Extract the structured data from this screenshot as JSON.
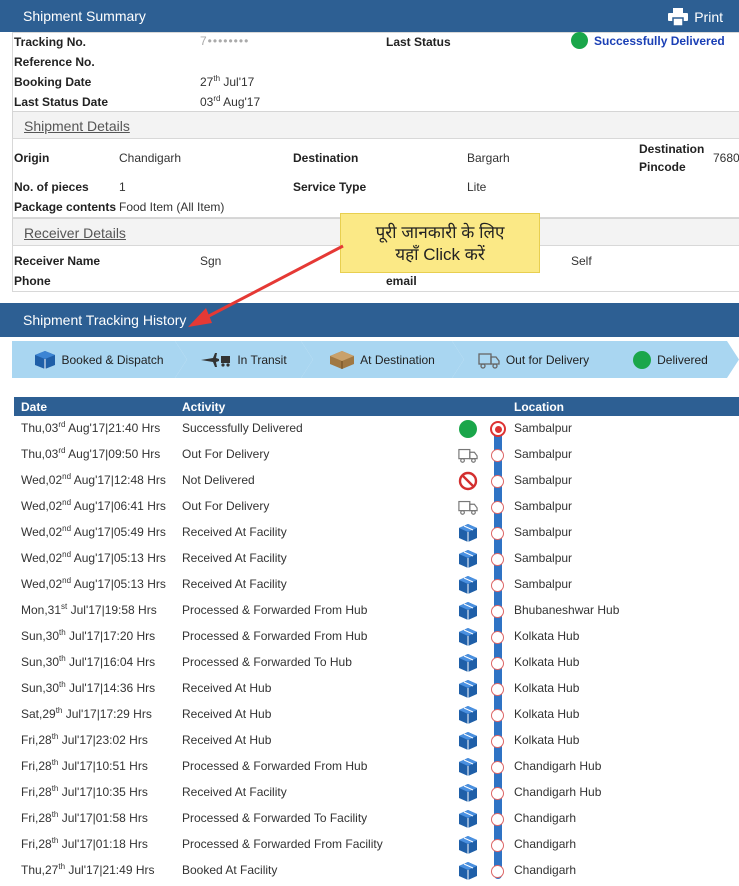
{
  "summary": {
    "title": "Shipment Summary",
    "print_label": "Print",
    "tracking_label": "Tracking No.",
    "tracking_value": "7••••••••",
    "last_status_label": "Last Status",
    "last_status_value": "Successfully Delivered",
    "reference_label": "Reference No.",
    "booking_label": "Booking Date",
    "booking_day": "27",
    "booking_sup": "th",
    "booking_rest": " Jul'17",
    "last_status_date_label": "Last Status Date",
    "last_status_day": "03",
    "last_status_sup": "rd",
    "last_status_rest": " Aug'17"
  },
  "details": {
    "title": "Shipment Details",
    "origin_label": "Origin",
    "origin_value": "Chandigarh",
    "destination_label": "Destination",
    "destination_value": "Bargarh",
    "pincode_label_1": "Destination",
    "pincode_label_2": "Pincode",
    "pincode_value": "7680",
    "pieces_label": "No. of pieces",
    "pieces_value": "1",
    "service_label": "Service Type",
    "service_value": "Lite",
    "contents_label": "Package contents",
    "contents_value": "Food Item (All Item)"
  },
  "receiver": {
    "title": "Receiver Details",
    "name_label": "Receiver Name",
    "name_value": "Sgn",
    "relation_value": "Self",
    "phone_label": "Phone",
    "email_label": "email"
  },
  "callout": {
    "line1": "पूरी जानकारी के लिए",
    "line2": "यहाँ Click करें"
  },
  "tracking": {
    "title": "Shipment Tracking History",
    "steps": [
      {
        "label": "Booked & Dispatch",
        "icon": "box-icon"
      },
      {
        "label": "In Transit",
        "icon": "transit-icon"
      },
      {
        "label": "At Destination",
        "icon": "package-icon"
      },
      {
        "label": "Out for Delivery",
        "icon": "delivery-van-icon"
      },
      {
        "label": "Delivered",
        "icon": "green-dot-icon"
      }
    ],
    "columns": {
      "date": "Date",
      "activity": "Activity",
      "location": "Location"
    },
    "rows": [
      {
        "d1": "Thu,03",
        "sup": "rd",
        "d2": " Aug'17|21:40 Hrs",
        "activity": "Successfully Delivered",
        "icon": "green-dot-icon",
        "location": "Sambalpur"
      },
      {
        "d1": "Thu,03",
        "sup": "rd",
        "d2": " Aug'17|09:50 Hrs",
        "activity": "Out For Delivery",
        "icon": "delivery-van-icon",
        "location": "Sambalpur"
      },
      {
        "d1": "Wed,02",
        "sup": "nd",
        "d2": " Aug'17|12:48 Hrs",
        "activity": "Not Delivered",
        "icon": "not-delivered-icon",
        "location": "Sambalpur"
      },
      {
        "d1": "Wed,02",
        "sup": "nd",
        "d2": " Aug'17|06:41 Hrs",
        "activity": "Out For Delivery",
        "icon": "delivery-van-icon",
        "location": "Sambalpur"
      },
      {
        "d1": "Wed,02",
        "sup": "nd",
        "d2": " Aug'17|05:49 Hrs",
        "activity": "Received At Facility",
        "icon": "box-icon",
        "location": "Sambalpur"
      },
      {
        "d1": "Wed,02",
        "sup": "nd",
        "d2": " Aug'17|05:13 Hrs",
        "activity": "Received At Facility",
        "icon": "box-icon",
        "location": "Sambalpur"
      },
      {
        "d1": "Wed,02",
        "sup": "nd",
        "d2": " Aug'17|05:13 Hrs",
        "activity": "Received At Facility",
        "icon": "box-icon",
        "location": "Sambalpur"
      },
      {
        "d1": "Mon,31",
        "sup": "st",
        "d2": " Jul'17|19:58 Hrs",
        "activity": "Processed & Forwarded From Hub",
        "icon": "box-icon",
        "location": "Bhubaneshwar Hub"
      },
      {
        "d1": "Sun,30",
        "sup": "th",
        "d2": " Jul'17|17:20 Hrs",
        "activity": "Processed & Forwarded From Hub",
        "icon": "box-icon",
        "location": "Kolkata Hub"
      },
      {
        "d1": "Sun,30",
        "sup": "th",
        "d2": " Jul'17|16:04 Hrs",
        "activity": "Processed & Forwarded To Hub",
        "icon": "box-icon",
        "location": "Kolkata Hub"
      },
      {
        "d1": "Sun,30",
        "sup": "th",
        "d2": " Jul'17|14:36 Hrs",
        "activity": "Received At Hub",
        "icon": "box-icon",
        "location": "Kolkata Hub"
      },
      {
        "d1": "Sat,29",
        "sup": "th",
        "d2": " Jul'17|17:29 Hrs",
        "activity": "Received At Hub",
        "icon": "box-icon",
        "location": "Kolkata Hub"
      },
      {
        "d1": "Fri,28",
        "sup": "th",
        "d2": " Jul'17|23:02 Hrs",
        "activity": "Received At Hub",
        "icon": "box-icon",
        "location": "Kolkata Hub"
      },
      {
        "d1": "Fri,28",
        "sup": "th",
        "d2": " Jul'17|10:51 Hrs",
        "activity": "Processed & Forwarded From Hub",
        "icon": "box-icon",
        "location": "Chandigarh Hub"
      },
      {
        "d1": "Fri,28",
        "sup": "th",
        "d2": " Jul'17|10:35 Hrs",
        "activity": "Received At Facility",
        "icon": "box-icon",
        "location": "Chandigarh Hub"
      },
      {
        "d1": "Fri,28",
        "sup": "th",
        "d2": " Jul'17|01:58 Hrs",
        "activity": "Processed & Forwarded To Facility",
        "icon": "box-icon",
        "location": "Chandigarh"
      },
      {
        "d1": "Fri,28",
        "sup": "th",
        "d2": " Jul'17|01:18 Hrs",
        "activity": "Processed & Forwarded From Facility",
        "icon": "box-icon",
        "location": "Chandigarh"
      },
      {
        "d1": "Thu,27",
        "sup": "th",
        "d2": " Jul'17|21:49 Hrs",
        "activity": "Booked At Facility",
        "icon": "box-icon",
        "location": "Chandigarh"
      }
    ]
  },
  "colors": {
    "header_blue": "#2d5f93",
    "step_blue": "#a9d6f1",
    "status_green": "#1aa64a",
    "delivered_text": "#1a3fb5",
    "arrow_red": "#e53935",
    "callout_yellow": "#fbe986"
  }
}
